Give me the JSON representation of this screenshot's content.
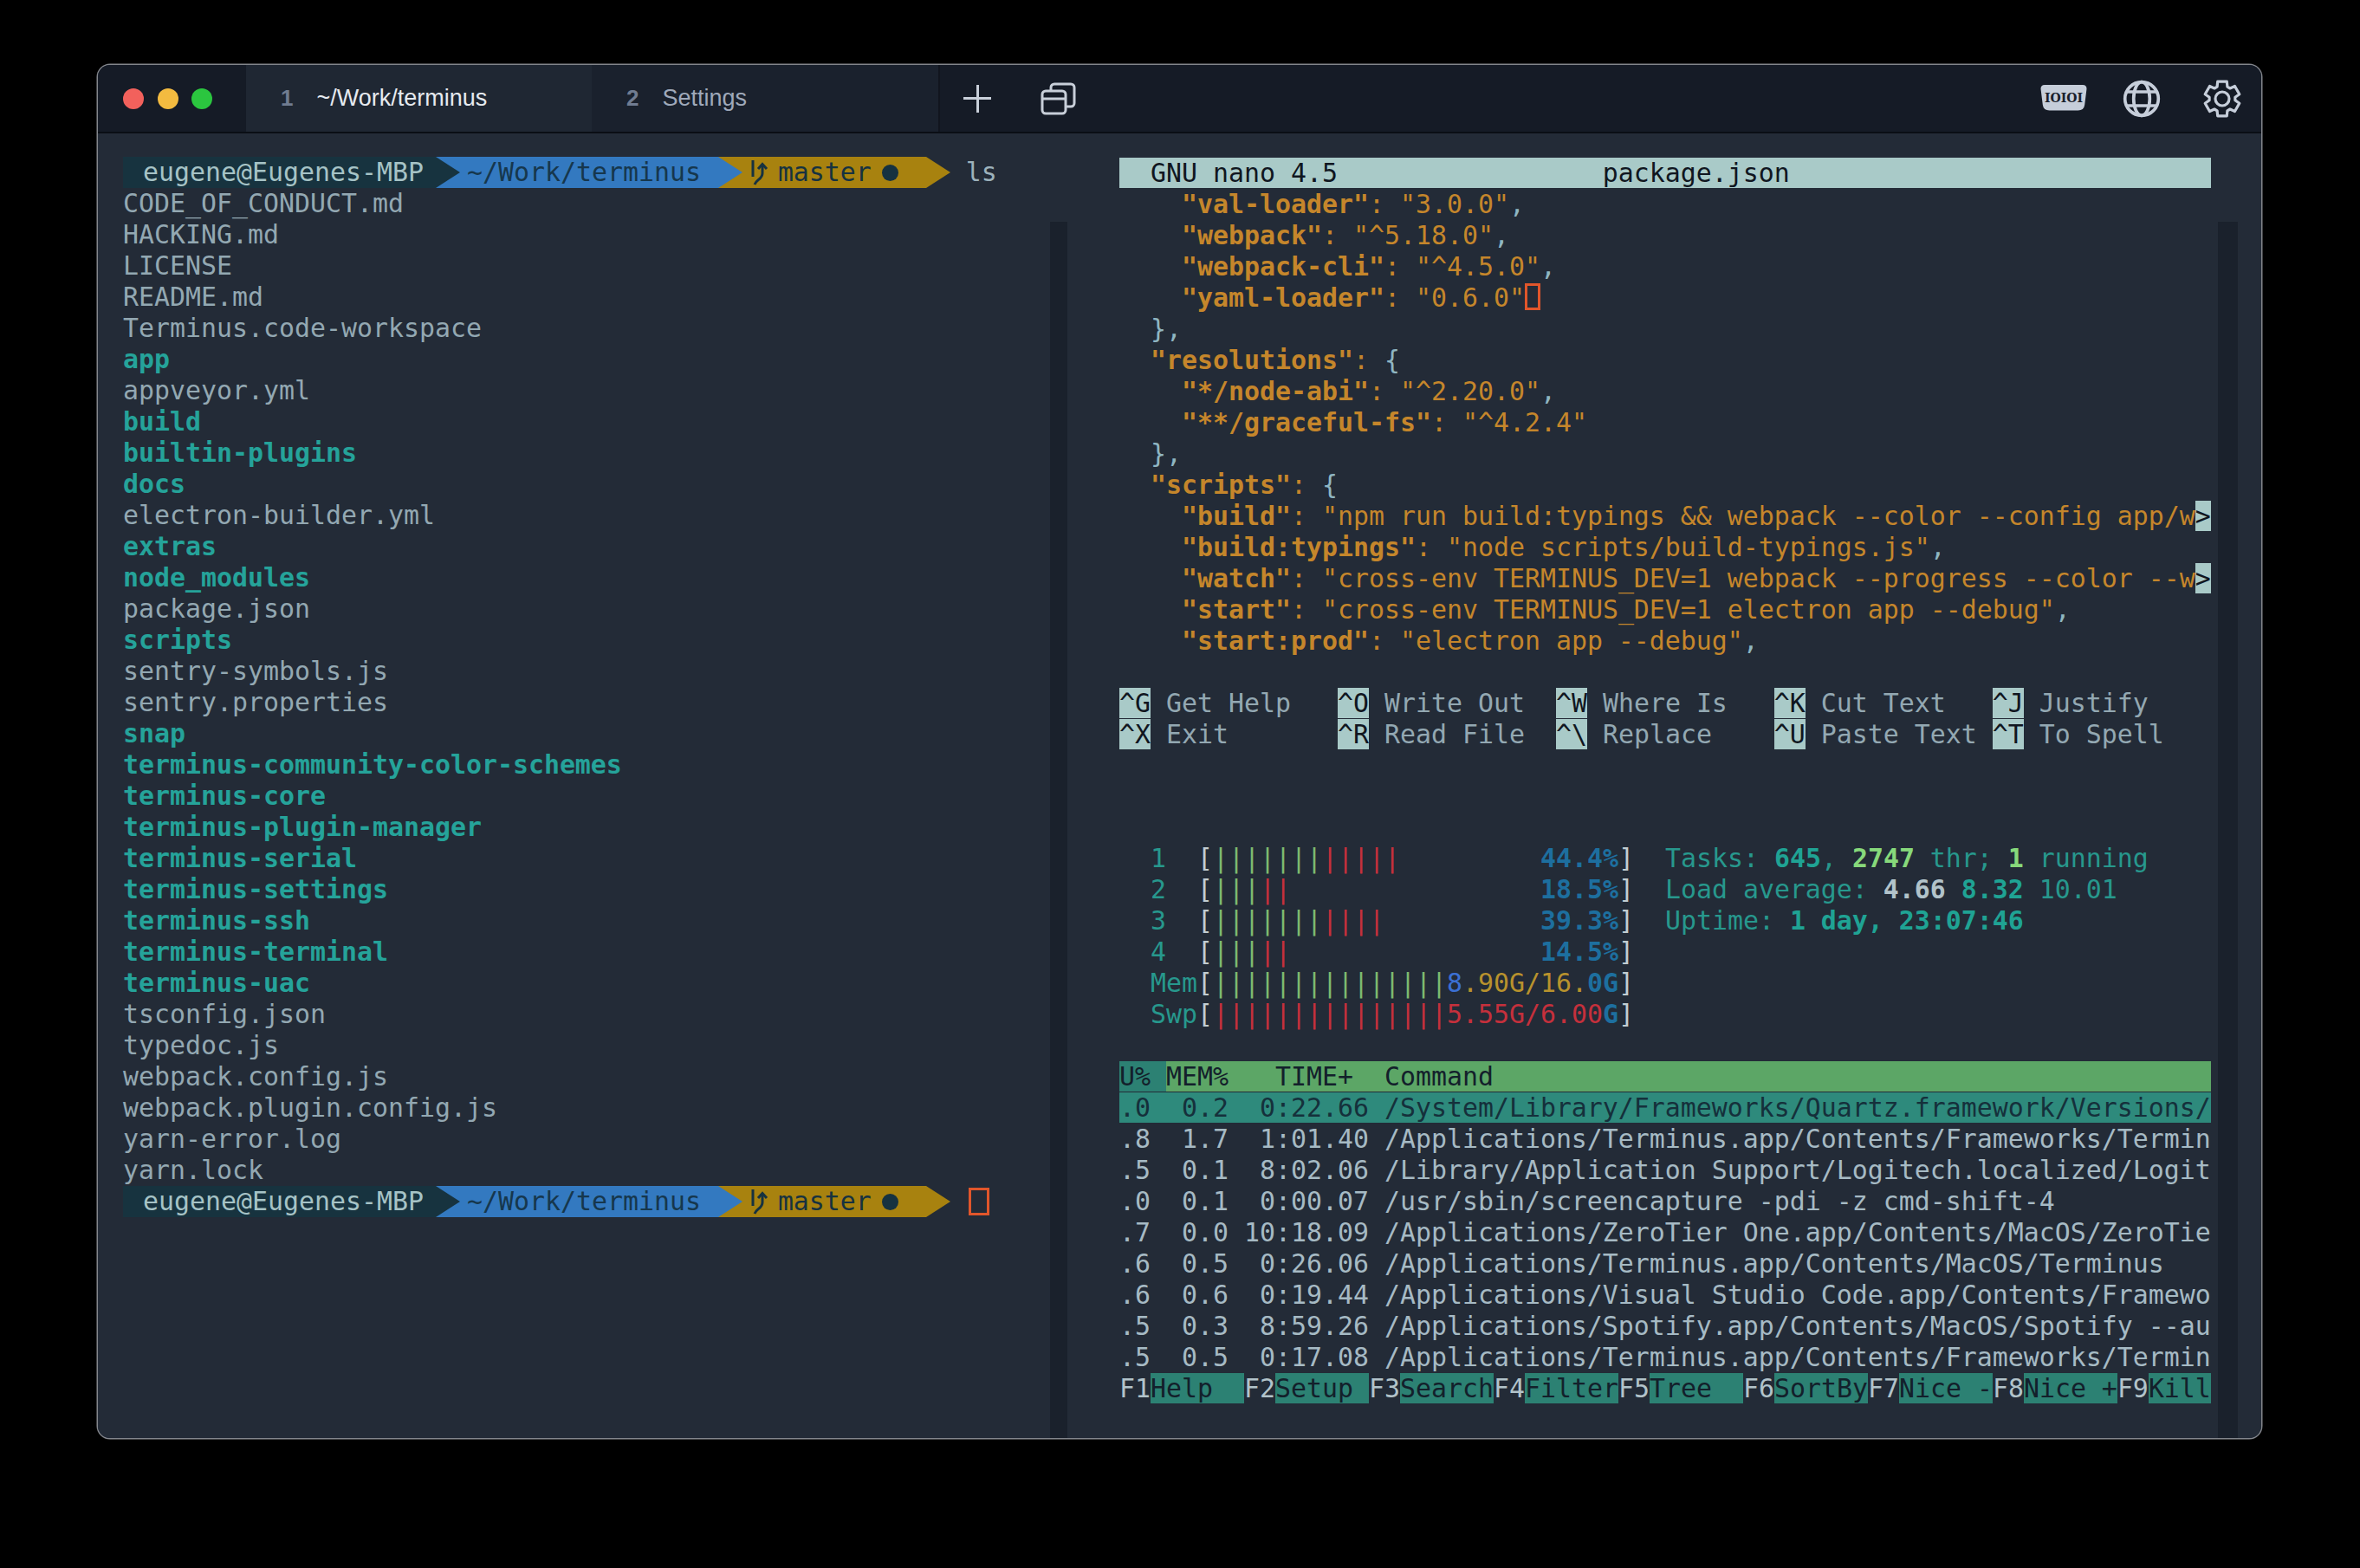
{
  "titlebar": {
    "tabs": [
      {
        "num": "1",
        "title": "~/Work/terminus",
        "active": true
      },
      {
        "num": "2",
        "title": "Settings",
        "active": false
      }
    ],
    "new_tab_label": "+",
    "serial_badge": "IOIOI"
  },
  "prompt": {
    "user": "eugene@Eugenes-MBP",
    "path": "~/Work/terminus",
    "branch": "master",
    "dirty_dot": "●",
    "command": "ls"
  },
  "ls": [
    [
      "f",
      "CODE_OF_CONDUCT.md"
    ],
    [
      "f",
      "HACKING.md"
    ],
    [
      "f",
      "LICENSE"
    ],
    [
      "f",
      "README.md"
    ],
    [
      "f",
      "Terminus.code-workspace"
    ],
    [
      "d",
      "app"
    ],
    [
      "f",
      "appveyor.yml"
    ],
    [
      "d",
      "build"
    ],
    [
      "d",
      "builtin-plugins"
    ],
    [
      "d",
      "docs"
    ],
    [
      "f",
      "electron-builder.yml"
    ],
    [
      "d",
      "extras"
    ],
    [
      "d",
      "node_modules"
    ],
    [
      "f",
      "package.json"
    ],
    [
      "d",
      "scripts"
    ],
    [
      "f",
      "sentry-symbols.js"
    ],
    [
      "f",
      "sentry.properties"
    ],
    [
      "d",
      "snap"
    ],
    [
      "d",
      "terminus-community-color-schemes"
    ],
    [
      "d",
      "terminus-core"
    ],
    [
      "d",
      "terminus-plugin-manager"
    ],
    [
      "d",
      "terminus-serial"
    ],
    [
      "d",
      "terminus-settings"
    ],
    [
      "d",
      "terminus-ssh"
    ],
    [
      "d",
      "terminus-terminal"
    ],
    [
      "d",
      "terminus-uac"
    ],
    [
      "f",
      "tsconfig.json"
    ],
    [
      "f",
      "typedoc.js"
    ],
    [
      "f",
      "webpack.config.js"
    ],
    [
      "f",
      "webpack.plugin.config.js"
    ],
    [
      "f",
      "yarn-error.log"
    ],
    [
      "f",
      "yarn.lock"
    ]
  ],
  "nano": {
    "lines": [
      {
        "tokens": [
          [
            "inv",
            "  GNU nano 4.5                 package.json                           "
          ]
        ]
      },
      {
        "tokens": [
          [
            "",
            "    "
          ],
          [
            "ob",
            "\"val-loader\""
          ],
          [
            "o",
            ": \"3.0.0\""
          ],
          [
            "p",
            ","
          ]
        ]
      },
      {
        "tokens": [
          [
            "",
            "    "
          ],
          [
            "ob",
            "\"webpack\""
          ],
          [
            "o",
            ": \"^5.18.0\""
          ],
          [
            "p",
            ","
          ]
        ]
      },
      {
        "tokens": [
          [
            "",
            "    "
          ],
          [
            "ob",
            "\"webpack-cli\""
          ],
          [
            "o",
            ": \"^4.5.0\""
          ],
          [
            "p",
            ","
          ]
        ]
      },
      {
        "tokens": [
          [
            "",
            "    "
          ],
          [
            "ob",
            "\"yaml-loader\""
          ],
          [
            "o",
            ": \"0.6.0\""
          ],
          [
            "cur",
            ""
          ]
        ]
      },
      {
        "tokens": [
          [
            "",
            "  "
          ],
          [
            "p",
            "},"
          ]
        ]
      },
      {
        "tokens": [
          [
            "",
            "  "
          ],
          [
            "ob",
            "\"resolutions\""
          ],
          [
            "o",
            ": "
          ],
          [
            "p",
            "{"
          ]
        ]
      },
      {
        "tokens": [
          [
            "",
            "    "
          ],
          [
            "ob",
            "\"*/node-abi\""
          ],
          [
            "o",
            ": \"^2.20.0\""
          ],
          [
            "p",
            ","
          ]
        ]
      },
      {
        "tokens": [
          [
            "",
            "    "
          ],
          [
            "ob",
            "\"**/graceful-fs\""
          ],
          [
            "o",
            ": \"^4.2.4\""
          ]
        ]
      },
      {
        "tokens": [
          [
            "",
            "  "
          ],
          [
            "p",
            "},"
          ]
        ]
      },
      {
        "tokens": [
          [
            "",
            "  "
          ],
          [
            "ob",
            "\"scripts\""
          ],
          [
            "o",
            ": "
          ],
          [
            "p",
            "{"
          ]
        ]
      },
      {
        "tokens": [
          [
            "",
            "    "
          ],
          [
            "ob",
            "\"build\""
          ],
          [
            "o",
            ": \"npm run build:typings && webpack --color --config app/w"
          ],
          [
            "inv",
            ">"
          ]
        ]
      },
      {
        "tokens": [
          [
            "",
            "    "
          ],
          [
            "ob",
            "\"build:typings\""
          ],
          [
            "o",
            ": \"node scripts/build-typings.js\""
          ],
          [
            "p",
            ","
          ]
        ]
      },
      {
        "tokens": [
          [
            "",
            "    "
          ],
          [
            "ob",
            "\"watch\""
          ],
          [
            "o",
            ": \"cross-env TERMINUS_DEV=1 webpack --progress --color --w"
          ],
          [
            "inv",
            ">"
          ]
        ]
      },
      {
        "tokens": [
          [
            "",
            "    "
          ],
          [
            "ob",
            "\"start\""
          ],
          [
            "o",
            ": \"cross-env TERMINUS_DEV=1 electron app --debug\""
          ],
          [
            "p",
            ","
          ]
        ]
      },
      {
        "tokens": [
          [
            "",
            "    "
          ],
          [
            "ob",
            "\"start:prod\""
          ],
          [
            "o",
            ": \"electron app --debug\""
          ],
          [
            "p",
            ","
          ]
        ]
      },
      {
        "tokens": []
      },
      {
        "tokens": [
          [
            "inv",
            "^G"
          ],
          [
            "f",
            " Get Help   "
          ],
          [
            "inv",
            "^O"
          ],
          [
            "f",
            " Write Out  "
          ],
          [
            "inv",
            "^W"
          ],
          [
            "f",
            " Where Is   "
          ],
          [
            "inv",
            "^K"
          ],
          [
            "f",
            " Cut Text   "
          ],
          [
            "inv",
            "^J"
          ],
          [
            "f",
            " Justify"
          ]
        ]
      },
      {
        "tokens": [
          [
            "inv",
            "^X"
          ],
          [
            "f",
            " Exit       "
          ],
          [
            "inv",
            "^R"
          ],
          [
            "f",
            " Read File  "
          ],
          [
            "inv",
            "^\\"
          ],
          [
            "f",
            " Replace    "
          ],
          [
            "inv",
            "^U"
          ],
          [
            "f",
            " Paste Text "
          ],
          [
            "inv",
            "^T"
          ],
          [
            "f",
            " To Spell"
          ]
        ]
      }
    ]
  },
  "htop": {
    "lines": [
      {
        "tokens": [
          [
            "t",
            "  1  "
          ],
          [
            "br",
            "["
          ],
          [
            "gr",
            "|||||||"
          ],
          [
            "rd",
            "|||||"
          ],
          [
            "",
            "         "
          ],
          [
            "pb",
            "44.4%"
          ],
          [
            "br",
            "]"
          ],
          [
            "",
            "  "
          ],
          [
            "t",
            "Tasks: "
          ],
          [
            "tb",
            "645"
          ],
          [
            "t",
            ", "
          ],
          [
            "gb",
            "2747"
          ],
          [
            "t",
            " thr; "
          ],
          [
            "gb",
            "1"
          ],
          [
            "t",
            " running"
          ]
        ]
      },
      {
        "tokens": [
          [
            "t",
            "  2  "
          ],
          [
            "br",
            "["
          ],
          [
            "gr",
            "|||"
          ],
          [
            "rd",
            "||"
          ],
          [
            "",
            "                "
          ],
          [
            "pb",
            "18.5%"
          ],
          [
            "br",
            "]"
          ],
          [
            "",
            "  "
          ],
          [
            "t",
            "Load average: "
          ],
          [
            "wb",
            "4.66 "
          ],
          [
            "tb",
            "8.32"
          ],
          [
            "t",
            " 10.01"
          ]
        ]
      },
      {
        "tokens": [
          [
            "t",
            "  3  "
          ],
          [
            "br",
            "["
          ],
          [
            "gr",
            "|||||||"
          ],
          [
            "rd",
            "||||"
          ],
          [
            "",
            "          "
          ],
          [
            "pb",
            "39.3%"
          ],
          [
            "br",
            "]"
          ],
          [
            "",
            "  "
          ],
          [
            "t",
            "Uptime: "
          ],
          [
            "tb",
            "1 day, 23:07:46"
          ]
        ]
      },
      {
        "tokens": [
          [
            "t",
            "  4  "
          ],
          [
            "br",
            "["
          ],
          [
            "gr",
            "|||"
          ],
          [
            "rd",
            "||"
          ],
          [
            "",
            "                "
          ],
          [
            "pb",
            "14.5%"
          ],
          [
            "br",
            "]"
          ]
        ]
      },
      {
        "tokens": [
          [
            "t",
            "  Mem"
          ],
          [
            "br",
            "["
          ],
          [
            "gr",
            "|||||||||||||||"
          ],
          [
            "mb",
            "8"
          ],
          [
            "y",
            ".90G/16."
          ],
          [
            "pb",
            "0G"
          ],
          [
            "br",
            "]"
          ]
        ]
      },
      {
        "tokens": [
          [
            "t",
            "  Swp"
          ],
          [
            "br",
            "["
          ],
          [
            "rd",
            "|||||||||||||||"
          ],
          [
            "rd",
            "5.55G/6.00"
          ],
          [
            "pb",
            "G"
          ],
          [
            "br",
            "]"
          ]
        ]
      },
      {
        "tokens": []
      },
      {
        "tokens": [
          [
            "hdrsel",
            "U% "
          ],
          [
            "hdr",
            "MEM%   TIME+  Command                                              "
          ]
        ]
      },
      {
        "tokens": [
          [
            "sel",
            ".0  0.2  0:22.66 /System/Library/Frameworks/Quartz.framework/Versions/"
          ]
        ]
      },
      {
        "tokens": [
          [
            "fh",
            ".8  1.7  1:01.40 /Applications/Terminus.app/Contents/Frameworks/Termin"
          ]
        ]
      },
      {
        "tokens": [
          [
            "fh",
            ".5  0.1  8:02.06 /Library/Application Support/Logitech.localized/Logit"
          ]
        ]
      },
      {
        "tokens": [
          [
            "fh",
            ".0  0.1  0:00.07 /usr/sbin/screencapture -pdi -z cmd-shift-4"
          ]
        ]
      },
      {
        "tokens": [
          [
            "fh",
            ".7  0.0 10:18.09 /Applications/ZeroTier One.app/Contents/MacOS/ZeroTie"
          ]
        ]
      },
      {
        "tokens": [
          [
            "fh",
            ".6  0.5  0:26.06 /Applications/Terminus.app/Contents/MacOS/Terminus"
          ]
        ]
      },
      {
        "tokens": [
          [
            "fh",
            ".6  0.6  0:19.44 /Applications/Visual Studio Code.app/Contents/Framewo"
          ]
        ]
      },
      {
        "tokens": [
          [
            "fh",
            ".5  0.3  8:59.26 /Applications/Spotify.app/Contents/MacOS/Spotify --au"
          ]
        ]
      },
      {
        "tokens": [
          [
            "fh",
            ".5  0.5  0:17.08 /Applications/Terminus.app/Contents/Frameworks/Termin"
          ]
        ]
      },
      {
        "tokens": [
          [
            "fk",
            "F1"
          ],
          [
            "fkl",
            "Help  "
          ],
          [
            "fk",
            "F2"
          ],
          [
            "fkl",
            "Setup "
          ],
          [
            "fk",
            "F3"
          ],
          [
            "fkl",
            "Search"
          ],
          [
            "fk",
            "F4"
          ],
          [
            "fkl",
            "Filter"
          ],
          [
            "fk",
            "F5"
          ],
          [
            "fkl",
            "Tree  "
          ],
          [
            "fk",
            "F6"
          ],
          [
            "fkl",
            "SortBy"
          ],
          [
            "fk",
            "F7"
          ],
          [
            "fkl",
            "Nice -"
          ],
          [
            "fk",
            "F8"
          ],
          [
            "fkl",
            "Nice +"
          ],
          [
            "fk",
            "F9"
          ],
          [
            "fkl",
            "Kill"
          ]
        ]
      }
    ]
  },
  "colors": {
    "bg": "#232B37",
    "tabbar": "#151B26",
    "tab_active": "#1F2733",
    "tab_inactive": "#19202B",
    "accent_orange": "#C5862B",
    "dir_teal": "#25A39A",
    "seg_host_bg": "#17333F",
    "seg_path_bg": "#3379C0",
    "seg_git_bg": "#A8820F",
    "cursor": "#E1562B",
    "nano_bar": "#A9CAC8",
    "htop_header_green": "#5CA666",
    "htop_sel_teal": "#2B8A7E",
    "fkey_teal": "#2C8173",
    "traffic_red": "#F2615C",
    "traffic_yellow": "#F3BB40",
    "traffic_green": "#2BC63F"
  }
}
